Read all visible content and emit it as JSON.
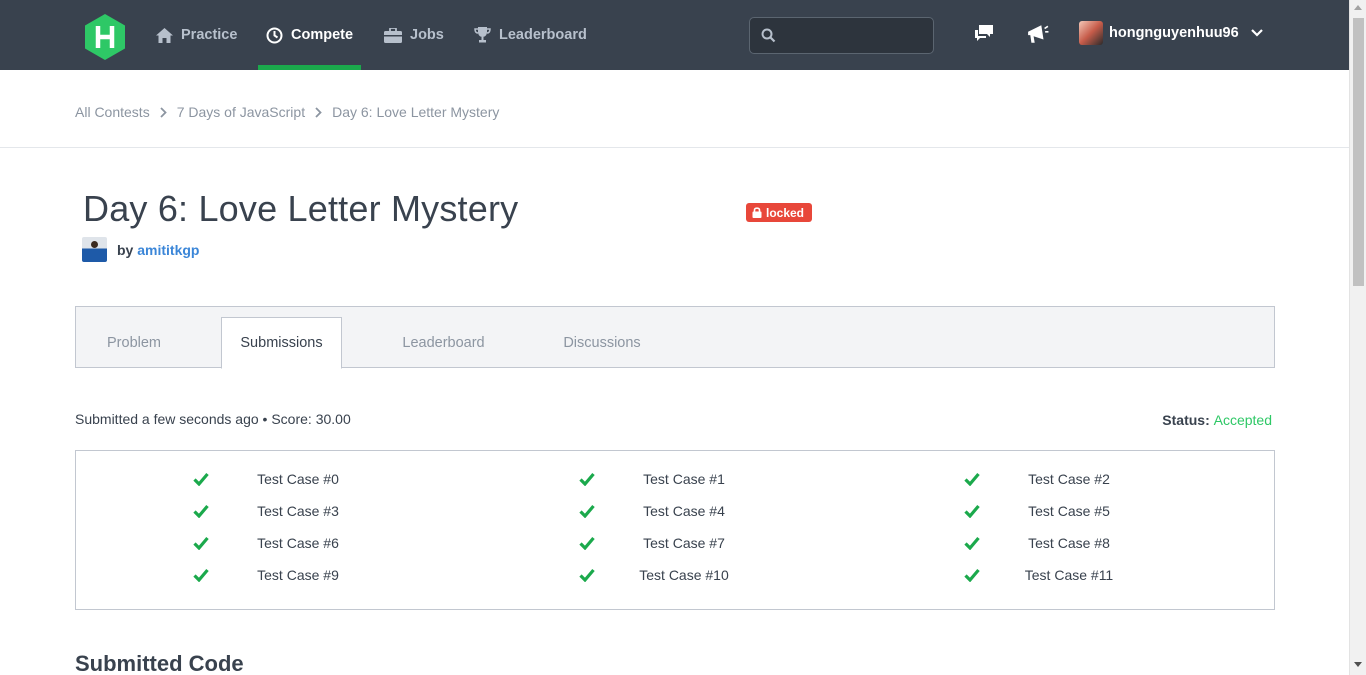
{
  "colors": {
    "nav_bg": "#39424e",
    "accent": "#1ba94c",
    "accepted": "#2ec866",
    "locked": "#e8473a",
    "link": "#3b86d8"
  },
  "nav": {
    "logo_icon": "hackerrank-logo-icon",
    "items": [
      {
        "label": "Practice",
        "icon": "home-icon"
      },
      {
        "label": "Compete",
        "icon": "clock-icon"
      },
      {
        "label": "Jobs",
        "icon": "briefcase-icon"
      },
      {
        "label": "Leaderboard",
        "icon": "trophy-icon"
      }
    ],
    "search_placeholder": "",
    "username": "hongnguyenhuu96"
  },
  "breadcrumb": [
    "All Contests",
    "7 Days of JavaScript",
    "Day 6: Love Letter Mystery"
  ],
  "challenge": {
    "title": "Day 6: Love Letter Mystery",
    "badge": "locked",
    "by_label": "by",
    "author": "amititkgp"
  },
  "tabs": [
    "Problem",
    "Submissions",
    "Leaderboard",
    "Discussions"
  ],
  "submission": {
    "summary": "Submitted a few seconds ago • Score: 30.00",
    "status_label": "Status:",
    "status_value": "Accepted"
  },
  "test_cases": [
    "Test Case #0",
    "Test Case #1",
    "Test Case #2",
    "Test Case #3",
    "Test Case #4",
    "Test Case #5",
    "Test Case #6",
    "Test Case #7",
    "Test Case #8",
    "Test Case #9",
    "Test Case #10",
    "Test Case #11"
  ],
  "code_section_title": "Submitted Code"
}
